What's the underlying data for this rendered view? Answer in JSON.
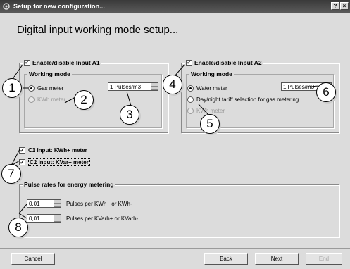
{
  "window": {
    "title": "Setup for new configuration...",
    "help_label": "?",
    "close_label": "×"
  },
  "page_title": "Digital input working mode setup...",
  "input_a1": {
    "enable_label": "Enable/disable Input A1",
    "enabled": true,
    "working_mode_label": "Working mode",
    "option_gas": "Gas meter",
    "option_kwh": "KWh meter",
    "pulse_value": "1 Pulses/m3"
  },
  "input_a2": {
    "enable_label": "Enable/disable Input A2",
    "enabled": true,
    "working_mode_label": "Working mode",
    "option_water": "Water meter",
    "option_tariff": "Day/night tariff selection for gas metering",
    "option_third": "KWh meter",
    "pulse_value": "1 Pulses/m3"
  },
  "c_inputs": {
    "c1_label": "C1 input: KWh+ meter",
    "c2_label": "C2 input: KVar+ meter",
    "c1_checked": true,
    "c2_checked": true
  },
  "pulse_rates": {
    "group_label": "Pulse rates for energy metering",
    "kwh_value": "0,01",
    "kwh_label": "Pulses per KWh+ or KWh-",
    "kvarh_value": "0,01",
    "kvarh_label": "Pulses per KVarh+ or KVarh-"
  },
  "footer": {
    "cancel": "Cancel",
    "back": "Back",
    "next": "Next",
    "end": "End"
  },
  "callouts": [
    "1",
    "2",
    "3",
    "4",
    "5",
    "6",
    "7",
    "8"
  ]
}
